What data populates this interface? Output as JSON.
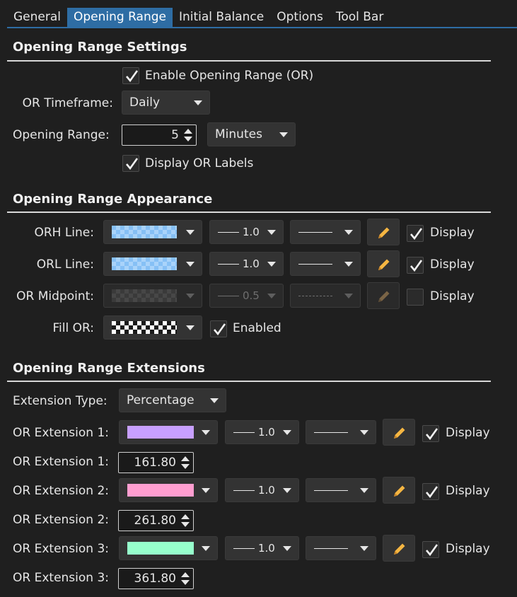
{
  "tabs": [
    {
      "label": "General"
    },
    {
      "label": "Opening Range"
    },
    {
      "label": "Initial Balance"
    },
    {
      "label": "Options"
    },
    {
      "label": "Tool Bar"
    }
  ],
  "active_tab": "Opening Range",
  "settings": {
    "title": "Opening Range Settings",
    "enable_label": "Enable Opening Range (OR)",
    "enable_checked": true,
    "timeframe_label": "OR Timeframe:",
    "timeframe_value": "Daily",
    "range_label": "Opening Range:",
    "range_value": "5",
    "range_unit": "Minutes",
    "display_labels_label": "Display OR Labels",
    "display_labels_checked": true
  },
  "appearance": {
    "title": "Opening Range Appearance",
    "display_label": "Display",
    "rows": [
      {
        "label": "ORH Line:",
        "width": "1.0",
        "display": true,
        "enabled": true
      },
      {
        "label": "ORL Line:",
        "width": "1.0",
        "display": true,
        "enabled": true
      },
      {
        "label": "OR Midpoint:",
        "width": "0.5",
        "display": false,
        "enabled": false
      }
    ],
    "fill_label": "Fill OR:",
    "fill_enabled_label": "Enabled",
    "fill_enabled": true
  },
  "extensions": {
    "title": "Opening Range Extensions",
    "type_label": "Extension Type:",
    "type_value": "Percentage",
    "display_label": "Display",
    "items": [
      {
        "label": "OR Extension 1:",
        "color": "#c8a0ff",
        "width": "1.0",
        "display": true,
        "value_label": "OR Extension 1:",
        "value": "161.80"
      },
      {
        "label": "OR Extension 2:",
        "color": "#ff9ed0",
        "width": "1.0",
        "display": true,
        "value_label": "OR Extension 2:",
        "value": "261.80"
      },
      {
        "label": "OR Extension 3:",
        "color": "#96ffcc",
        "width": "1.0",
        "display": true,
        "value_label": "OR Extension 3:",
        "value": "361.80"
      }
    ]
  },
  "colors": {
    "accent": "#2e6da4",
    "pencil": "#f5b642",
    "background": "#1f1f1f"
  }
}
